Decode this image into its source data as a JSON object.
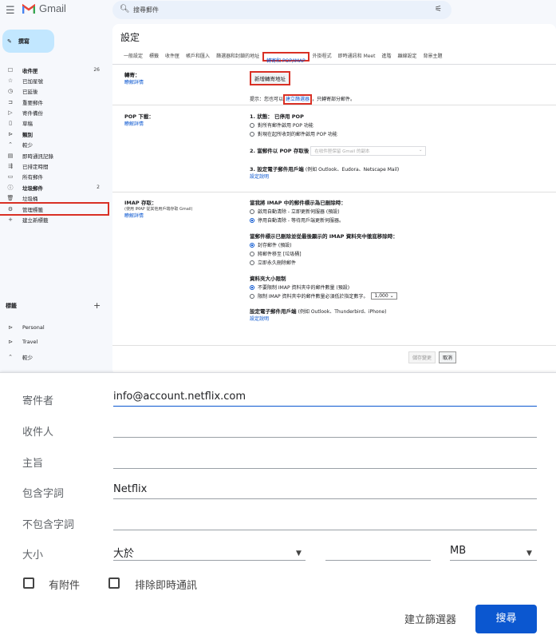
{
  "header": {
    "app_name": "Gmail",
    "search_placeholder": "搜尋郵件"
  },
  "compose_label": "撰寫",
  "nav": [
    {
      "icon": "inbox-icon",
      "label": "收件匣",
      "count": "26",
      "bold": true
    },
    {
      "icon": "star-icon",
      "label": "已加星號"
    },
    {
      "icon": "clock-icon",
      "label": "已延後"
    },
    {
      "icon": "important-icon",
      "label": "重要郵件"
    },
    {
      "icon": "send-icon",
      "label": "寄件備份"
    },
    {
      "icon": "draft-icon",
      "label": "草稿"
    },
    {
      "icon": "label-icon",
      "label": "類別",
      "bold": true
    },
    {
      "icon": "chevron-up-icon",
      "label": "較少"
    },
    {
      "icon": "chat-icon",
      "label": "即時通訊記錄"
    },
    {
      "icon": "scheduled-icon",
      "label": "已排定時間"
    },
    {
      "icon": "all-mail-icon",
      "label": "所有郵件"
    },
    {
      "icon": "spam-icon",
      "label": "垃圾郵件",
      "count": "2",
      "bold": true
    },
    {
      "icon": "trash-icon",
      "label": "垃圾桶"
    },
    {
      "icon": "gear-icon",
      "label": "管理標籤",
      "highlight": true
    },
    {
      "icon": "plus-icon",
      "label": "建立新標籤"
    }
  ],
  "labels_heading": "標籤",
  "labels": [
    {
      "icon": "label-icon",
      "label": "Personal"
    },
    {
      "icon": "label-icon",
      "label": "Travel"
    },
    {
      "icon": "chevron-up-icon",
      "label": "較少"
    }
  ],
  "settings": {
    "title": "設定",
    "tabs": [
      "一般設定",
      "標籤",
      "收件匣",
      "帳戶和匯入",
      "篩選器和封鎖的地址",
      "轉寄和 POP/IMAP",
      "外掛程式",
      "即時通訊和 Meet",
      "進階",
      "離線設定",
      "背景主題"
    ],
    "active_tab": 5,
    "forward": {
      "heading": "轉寄：",
      "learn_more": "瞭解詳情",
      "add_button": "新增轉寄地址",
      "tip_prefix": "提示：您也可以",
      "tip_link": "建立篩選器",
      "tip_suffix": "，只轉寄部分郵件。"
    },
    "pop": {
      "heading": "POP 下載：",
      "learn_more": "瞭解詳情",
      "s1": "1. 狀態： 已停用 POP",
      "o1": "對所有郵件啟用 POP 功能",
      "o2": "對現在起所收到的郵件啟用 POP 功能",
      "s2": "2. 當郵件以 POP 存取後",
      "s2_select": "在收件匣保留 Gmail 的副本",
      "s3": "3. 設定電子郵件用戶端",
      "s3_note": "(例如 Outlook、Eudora、Netscape Mail)",
      "s3_link": "設定說明"
    },
    "imap": {
      "heading": "IMAP 存取：",
      "sub": "(使用 IMAP 從其他用戶端存取 Gmail)",
      "learn_more": "瞭解詳情",
      "q1": "當我將 IMAP 中的郵件標示為已刪除時：",
      "q1o1": "啟用自動清除 - 立即更新伺服器 (預設)",
      "q1o2": "停用自動清除 - 等待用戶端更新伺服器。",
      "q2": "當郵件標示已刪除並從最後顯示的 IMAP 資料夾中徹底移除時：",
      "q2o1": "封存郵件 (預設)",
      "q2o2": "將郵件移至 [垃圾桶]",
      "q2o3": "立即永久刪除郵件",
      "q3": "資料夾大小限制",
      "q3o1": "不要限制 IMAP 資料夾中的郵件數量 (預設)",
      "q3o2": "限制 IMAP 資料夾中的郵件數量必須低於指定數字。",
      "q3_select": "1,000",
      "q4": "設定電子郵件用戶端",
      "q4_note": "(例如 Outlook、Thunderbird、iPhone)",
      "q4_link": "設定說明"
    },
    "save_button": "儲存變更",
    "cancel_button": "取消"
  },
  "filter": {
    "from_label": "寄件者",
    "from_value": "info@account.netflix.com",
    "to_label": "收件人",
    "to_value": "",
    "subject_label": "主旨",
    "subject_value": "",
    "has_words_label": "包含字詞",
    "has_words_value": "Netflix",
    "not_words_label": "不包含字詞",
    "not_words_value": "",
    "size_label": "大小",
    "size_op": "大於",
    "size_value": "",
    "size_unit": "MB",
    "attachment_label": "有附件",
    "exclude_chats_label": "排除即時通訊",
    "create_filter": "建立篩選器",
    "search_button": "搜尋"
  }
}
